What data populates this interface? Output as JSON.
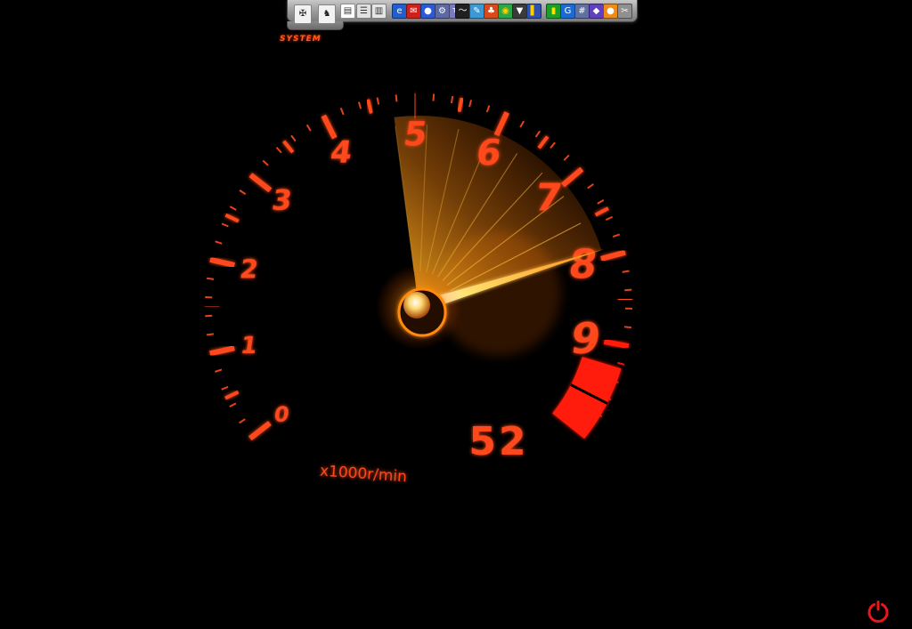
{
  "gauge": {
    "numerals": [
      "0",
      "1",
      "2",
      "3",
      "4",
      "5",
      "6",
      "7",
      "8",
      "9"
    ],
    "unit_label": "x1000r/min",
    "readout": "52",
    "needle_rpm_thousands": 7.9,
    "color_primary": "#ff4a1a",
    "color_glow": "#ffb020",
    "color_redline": "#ff1a0a"
  },
  "dock": {
    "system_label": "SYSTEM",
    "icons": [
      {
        "name": "eagle-crest-icon",
        "glyph": "✠",
        "bg": "#f2f2f2",
        "fg": "#222222"
      },
      {
        "name": "griffin-crest-icon",
        "glyph": "♞",
        "bg": "#f2f2f2",
        "fg": "#222222"
      },
      {
        "name": "document-icon",
        "glyph": "▤",
        "bg": "#ffffff",
        "fg": "#333333"
      },
      {
        "name": "archive-icon",
        "glyph": "☰",
        "bg": "#e0e0e0",
        "fg": "#333333"
      },
      {
        "name": "server-icon",
        "glyph": "▥",
        "bg": "#e6e6e6",
        "fg": "#333333"
      },
      {
        "name": "ie-icon",
        "glyph": "e",
        "bg": "#1f5fd0",
        "fg": "#ffffff"
      },
      {
        "name": "mail-icon",
        "glyph": "✉",
        "bg": "#d0201a",
        "fg": "#ffffff"
      },
      {
        "name": "globe-icon",
        "glyph": "●",
        "bg": "#2a5ad8",
        "fg": "#ffffff"
      },
      {
        "name": "gear-icon",
        "glyph": "⚙",
        "bg": "#5a6aa8",
        "fg": "#ffffff"
      },
      {
        "name": "ts-icon",
        "glyph": "TS",
        "bg": "#7a7ac0",
        "fg": "#ffffff"
      },
      {
        "name": "signature-icon",
        "glyph": "〜",
        "bg": "#202020",
        "fg": "#ffffff"
      },
      {
        "name": "paint-icon",
        "glyph": "✎",
        "bg": "#3a9ad8",
        "fg": "#ffffff"
      },
      {
        "name": "game-icon",
        "glyph": "♣",
        "bg": "#d84a1a",
        "fg": "#ffffff"
      },
      {
        "name": "colors-icon",
        "glyph": "◉",
        "bg": "#28a848",
        "fg": "#ffd000"
      },
      {
        "name": "pin-icon",
        "glyph": "▼",
        "bg": "#3a3a3a",
        "fg": "#ffffff"
      },
      {
        "name": "rack-icon",
        "glyph": "▌",
        "bg": "#3050b0",
        "fg": "#ffd000"
      },
      {
        "name": "chart-icon",
        "glyph": "▮",
        "bg": "#18a028",
        "fg": "#ffe000"
      },
      {
        "name": "g-icon",
        "glyph": "G",
        "bg": "#1a6ad8",
        "fg": "#ffffff"
      },
      {
        "name": "grid-icon",
        "glyph": "#",
        "bg": "#6070a0",
        "fg": "#ffffff"
      },
      {
        "name": "network-icon",
        "glyph": "◆",
        "bg": "#6040c0",
        "fg": "#ffffff"
      },
      {
        "name": "orange-icon",
        "glyph": "●",
        "bg": "#f08a18",
        "fg": "#ffffff"
      },
      {
        "name": "tools-icon",
        "glyph": "✂",
        "bg": "#909090",
        "fg": "#ffffff"
      }
    ]
  },
  "power": {
    "icon": "power-icon",
    "color": "#e8181a"
  }
}
